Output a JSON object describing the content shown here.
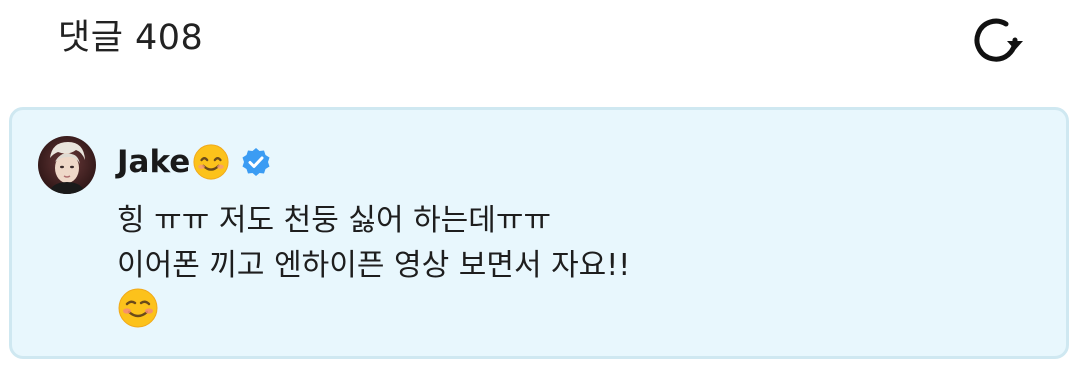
{
  "header": {
    "title": "댓글 408",
    "refresh_icon": "refresh-icon"
  },
  "comment": {
    "author": "Jake",
    "author_emoji": "smiling-face-icon",
    "verified_icon": "verified-badge-icon",
    "lines": [
      "힝 ㅠㅠ 저도 천둥 싫어 하는데ㅠㅠ",
      "이어폰 끼고 엔하이픈 영상 보면서 자요!!"
    ],
    "trailing_emoji": "blushing-smile-icon",
    "card_bg": "#e8f7fd",
    "card_border": "#cfe8f1",
    "verified_color": "#3b9cf3"
  }
}
